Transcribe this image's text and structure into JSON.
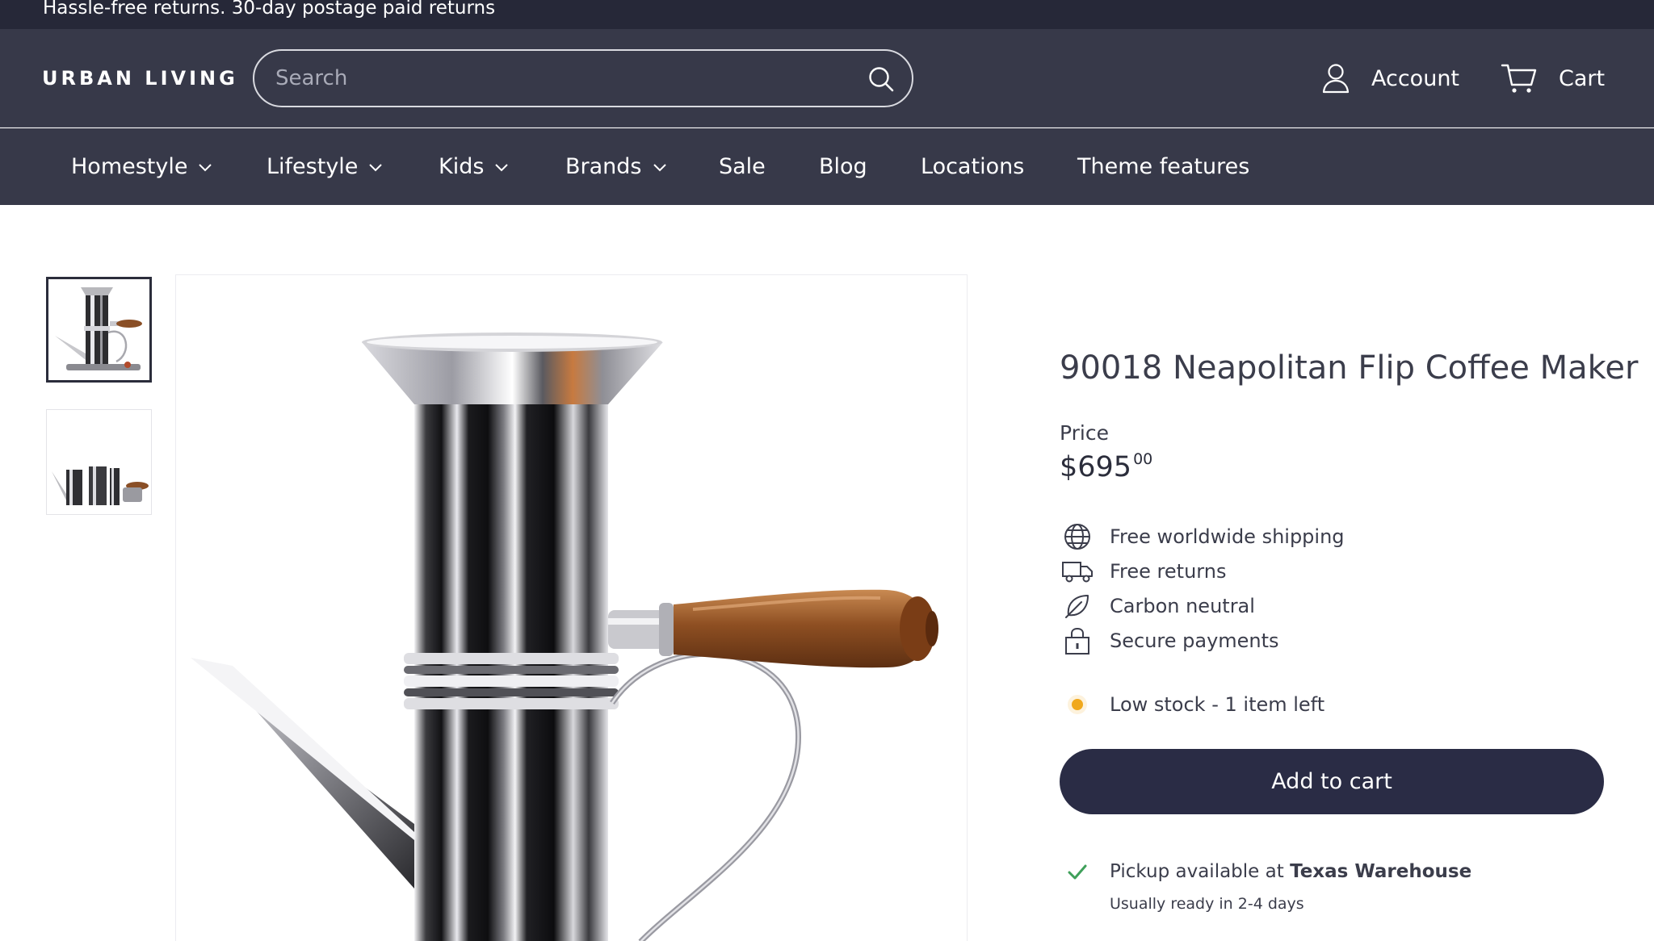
{
  "announcement": {
    "text": "Hassle-free returns. 30-day postage paid returns"
  },
  "header": {
    "logo": "URBAN LIVING",
    "search_placeholder": "Search",
    "account_label": "Account",
    "cart_label": "Cart"
  },
  "nav": {
    "items": [
      {
        "label": "Homestyle",
        "has_dropdown": true
      },
      {
        "label": "Lifestyle",
        "has_dropdown": true
      },
      {
        "label": "Kids",
        "has_dropdown": true
      },
      {
        "label": "Brands",
        "has_dropdown": true
      },
      {
        "label": "Sale",
        "has_dropdown": false
      },
      {
        "label": "Blog",
        "has_dropdown": false
      },
      {
        "label": "Locations",
        "has_dropdown": false
      },
      {
        "label": "Theme features",
        "has_dropdown": false
      }
    ]
  },
  "product": {
    "title": "90018 Neapolitan Flip Coffee Maker",
    "price_label": "Price",
    "price_main": "$695",
    "price_cents": "00",
    "features": [
      {
        "icon": "globe-icon",
        "text": "Free worldwide shipping"
      },
      {
        "icon": "truck-icon",
        "text": "Free returns"
      },
      {
        "icon": "leaf-icon",
        "text": "Carbon neutral"
      },
      {
        "icon": "lock-icon",
        "text": "Secure payments"
      }
    ],
    "stock_text": "Low stock - 1 item left",
    "add_to_cart_label": "Add to cart",
    "pickup_prefix": "Pickup available at ",
    "pickup_location": "Texas Warehouse",
    "pickup_ready": "Usually ready in 2-4 days"
  },
  "colors": {
    "announce_bg": "#262838",
    "header_bg": "#373949",
    "button_bg": "#2a2c45",
    "stock_dot": "#f0a81c",
    "check": "#3fa05a"
  }
}
